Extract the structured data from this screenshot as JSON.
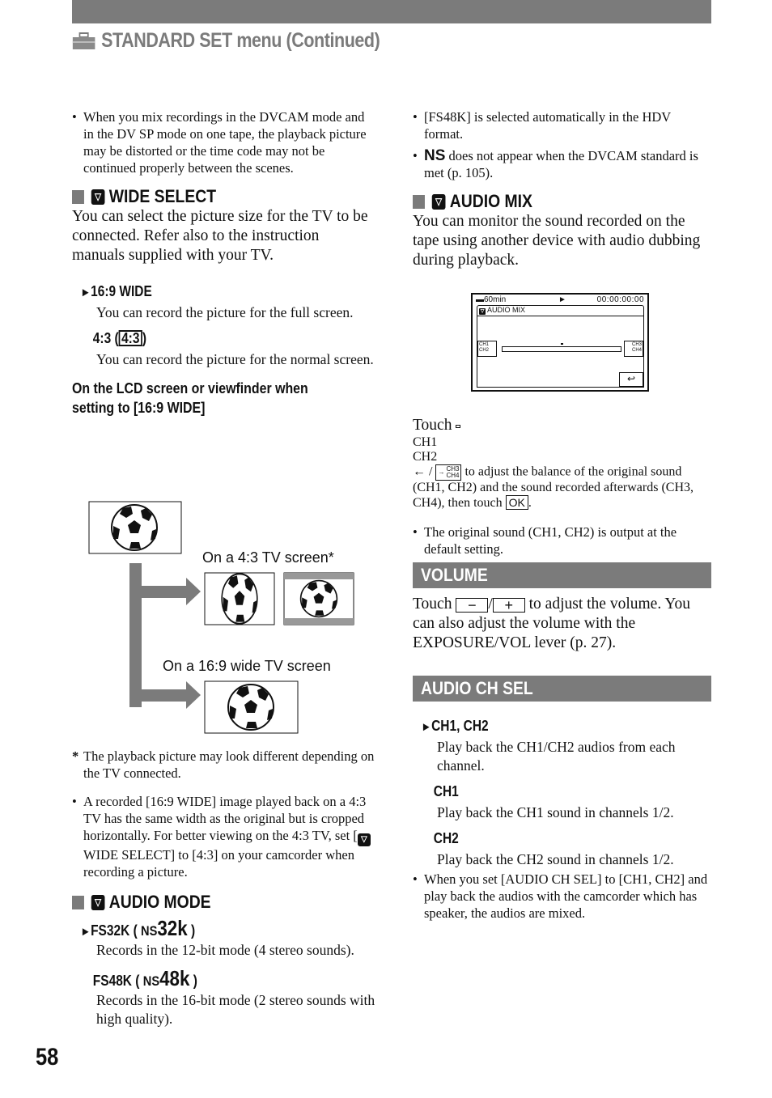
{
  "header": {
    "title": "STANDARD SET menu (Continued)",
    "icon": "toolbox-icon"
  },
  "left": {
    "intro_bullet": "When you mix recordings in the DVCAM mode and in the DV SP mode on one tape, the playback picture may be distorted or the time code may not be continued properly between the scenes.",
    "wide_select": {
      "heading": "WIDE SELECT",
      "body": "You can select the picture size for the TV to be connected. Refer also to the instruction manuals supplied with your TV.",
      "options": [
        {
          "label": "16:9 WIDE",
          "default": true,
          "desc": "You can record the picture for the full screen."
        },
        {
          "label": "4:3 (",
          "badge": "4:3",
          "suffix": ")",
          "desc": "You can record the picture for the normal screen."
        }
      ],
      "caption": [
        "On the LCD screen or viewfinder when",
        "setting to [16:9 WIDE]"
      ],
      "diagram": {
        "label_43": "On a 4:3 TV screen*",
        "label_169": "On a 16:9 wide TV screen"
      },
      "footnote": "The playback picture may look different depending on the TV connected.",
      "bullet_pre": "A recorded [16:9 WIDE] image played back on a 4:3 TV has the same width as the original but is cropped horizontally. For better viewing on the 4:3 TV, set [",
      "bullet_post": " WIDE SELECT] to [4:3] on your camcorder when recording a picture."
    },
    "audio_mode": {
      "heading": "AUDIO MODE",
      "options": [
        {
          "label": "FS32K (",
          "ns": "NS",
          "rate": "32k",
          "suffix": ")",
          "default": true,
          "desc": "Records in the 12-bit mode (4 stereo sounds)."
        },
        {
          "label": "FS48K (",
          "ns": "NS",
          "rate": "48k",
          "suffix": ")",
          "desc": "Records in the 16-bit mode (2 stereo sounds with high quality)."
        }
      ]
    }
  },
  "right": {
    "bullet1": "[FS48K] is selected automatically in the HDV format.",
    "bullet2_ns": "NS",
    "bullet2": " does not appear when the DVCAM standard is met (p. 105).",
    "audio_mix": {
      "heading": "AUDIO MIX",
      "body": "You can monitor the sound recorded on the tape using another device with audio dubbing during playback.",
      "lcd": {
        "battery": "60min",
        "play": "►",
        "timecode": "00:00:00:00",
        "menu_title": "AUDIO  MIX",
        "left_btn": [
          "CH1",
          "CH2"
        ],
        "right_btn": [
          "CH3",
          "CH4"
        ],
        "balance": 0.5
      },
      "touch_pre": "Touch",
      "touch_sep": "/",
      "touch_post": " to adjust the balance of the original sound (CH1, CH2) and the sound recorded afterwards (CH3, CH4), then touch",
      "ok_label": "OK",
      "touch_end": ".",
      "note": "The original sound (CH1, CH2) is output at the default setting."
    },
    "volume": {
      "heading": "VOLUME",
      "pre": "Touch",
      "minus": "−",
      "slash": "/",
      "plus": "+",
      "post": " to adjust the volume. You can also adjust the volume with the EXPOSURE/VOL lever (p. 27)."
    },
    "audio_ch_sel": {
      "heading": "AUDIO CH SEL",
      "options": [
        {
          "label": "CH1, CH2",
          "default": true,
          "desc": "Play back the CH1/CH2 audios from each channel."
        },
        {
          "label": "CH1",
          "desc": "Play back the CH1 sound in channels 1/2."
        },
        {
          "label": "CH2",
          "desc": "Play back the CH2 sound in channels 1/2."
        }
      ],
      "note": "When you set [AUDIO CH SEL] to [CH1, CH2] and play back the audios with the camcorder which has speaker, the audios are mixed."
    }
  },
  "footer": {
    "page_number": "58"
  },
  "colors": {
    "accent_gray": "#7b7b7b"
  }
}
